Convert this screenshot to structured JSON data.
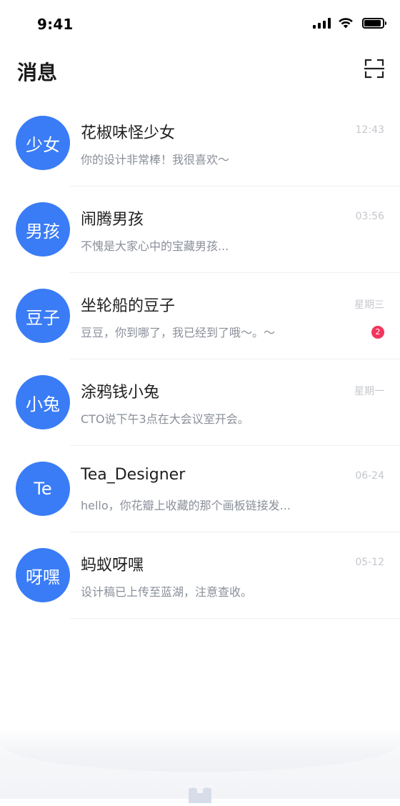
{
  "status_bar": {
    "time": "9:41",
    "signal_icon": "signal-bars-icon",
    "wifi_icon": "wifi-icon",
    "battery_icon": "battery-icon",
    "battery_level": 0.9
  },
  "header": {
    "title": "消息",
    "scan_icon": "scan-icon"
  },
  "colors": {
    "avatar": "#3a7cf6",
    "badge": "#f2365d",
    "name": "#1f1f1f",
    "preview": "#8a8f99",
    "time": "#c4c7cc"
  },
  "conversations": [
    {
      "avatar": "少女",
      "name": "花椒味怪少女",
      "preview": "你的设计非常棒！我很喜欢～",
      "time": "12:43",
      "unread": ""
    },
    {
      "avatar": "男孩",
      "name": "闹腾男孩",
      "preview": "不愧是大家心中的宝藏男孩...",
      "time": "03:56",
      "unread": ""
    },
    {
      "avatar": "豆子",
      "name": "坐轮船的豆子",
      "preview": "豆豆，你到哪了，我已经到了哦～。～",
      "time": "星期三",
      "unread": "2"
    },
    {
      "avatar": "小兔",
      "name": "涂鸦钱小兔",
      "preview": "CTO说下午3点在大会议室开会。",
      "time": "星期一",
      "unread": ""
    },
    {
      "avatar": "Te",
      "name": "Tea_Designer",
      "preview": "hello，你花瓣上收藏的那个画板链接发...",
      "time": "06-24",
      "unread": ""
    },
    {
      "avatar": "呀嘿",
      "name": "蚂蚁呀嘿",
      "preview": "设计稿已上传至蓝湖，注意查收。",
      "time": "05-12",
      "unread": ""
    }
  ],
  "tabbar": {
    "home_icon": "home-icon"
  }
}
